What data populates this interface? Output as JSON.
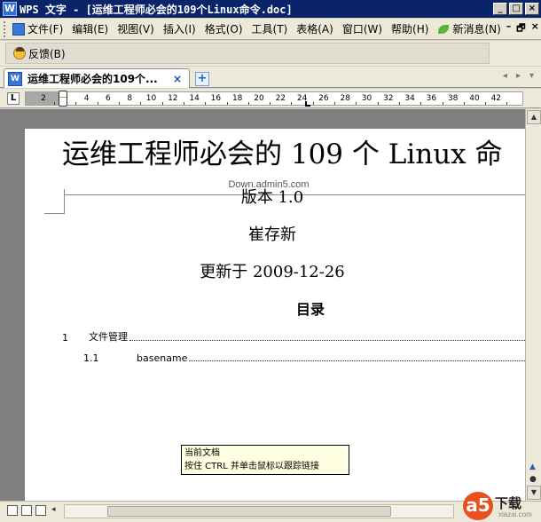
{
  "window": {
    "app_icon_letter": "W",
    "title": "WPS 文字 - [运维工程师必会的109个Linux命令.doc]",
    "btn_minimize": "_",
    "btn_maximize": "□",
    "btn_close": "×"
  },
  "menu": {
    "items": [
      "文件(F)",
      "编辑(E)",
      "视图(V)",
      "插入(I)",
      "格式(O)",
      "工具(T)",
      "表格(A)",
      "窗口(W)",
      "帮助(H)"
    ],
    "news": "新消息(N)",
    "mdi_min": "–",
    "mdi_restore": "🗗",
    "mdi_close": "×"
  },
  "feedback": {
    "label": "反馈(B)"
  },
  "tabs": {
    "active_label": "运维工程师必会的109个...",
    "close": "×",
    "new": "+",
    "nav_left": "◂",
    "nav_right": "▸",
    "nav_menu": "▾"
  },
  "ruler": {
    "corner": "L",
    "labels": [
      "2",
      "2",
      "4",
      "6",
      "8",
      "10",
      "12",
      "14",
      "16",
      "18",
      "20",
      "22",
      "24",
      "26",
      "28",
      "30",
      "32",
      "34",
      "36",
      "38",
      "40",
      "42"
    ]
  },
  "document": {
    "header": "Down.admin5.com",
    "title": "运维工程师必会的 109 个 Linux 命",
    "version": "版本 1.0",
    "author": "崔存新",
    "date": "更新于 2009-12-26",
    "toc_heading": "目录",
    "toc": [
      {
        "num": "1",
        "label": "文件管理"
      },
      {
        "num": "1.1",
        "label": "basename"
      }
    ]
  },
  "tooltip": {
    "line1": "当前文档",
    "line2": "按住 CTRL 并单击鼠标以跟踪链接"
  },
  "scrollbar": {
    "up": "▲",
    "down": "▼",
    "prev_page": "▲",
    "select_browse": "●"
  },
  "bottombar": {
    "hs_left": "◂"
  },
  "logo": {
    "mark": "a5",
    "text": "下载",
    "sub": "xiazai.com"
  },
  "colors": {
    "titlebar": "#0a246a",
    "accent": "#3a76d6",
    "logo": "#e8501e"
  }
}
